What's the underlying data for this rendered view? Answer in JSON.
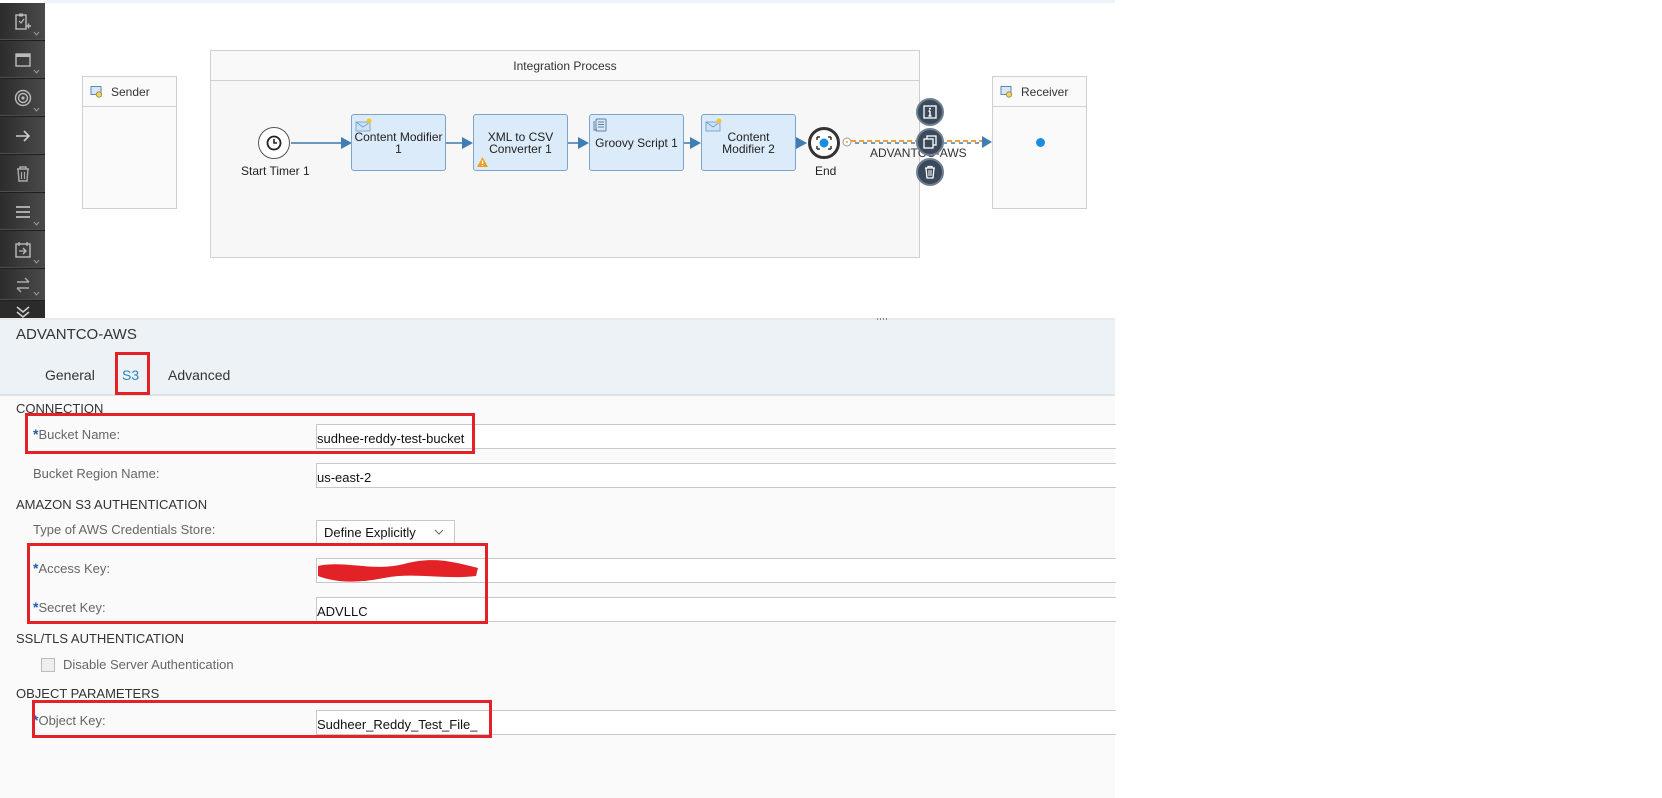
{
  "palette": {
    "items": [
      {
        "icon": "clipboard-add-icon",
        "has_dropdown": true
      },
      {
        "icon": "window-icon",
        "has_dropdown": true
      },
      {
        "icon": "target-icon",
        "has_dropdown": true
      },
      {
        "icon": "arrow-right-icon",
        "has_dropdown": false
      },
      {
        "icon": "trash-icon",
        "has_dropdown": false
      },
      {
        "icon": "menu-lines-icon",
        "has_dropdown": true
      },
      {
        "icon": "calendar-import-icon",
        "has_dropdown": true
      },
      {
        "icon": "swap-arrows-icon",
        "has_dropdown": true
      }
    ],
    "collapse_icon": "double-chevron-down-icon"
  },
  "diagram": {
    "sender": {
      "label": "Sender"
    },
    "receiver": {
      "label": "Receiver"
    },
    "pool": {
      "label": "Integration Process"
    },
    "start_event": {
      "label": "Start Timer 1",
      "icon": "clock-icon"
    },
    "steps": [
      {
        "label": "Content Modifier 1",
        "icon": "envelope-icon",
        "warning": false
      },
      {
        "label": "XML to CSV Converter 1",
        "icon": "",
        "warning": true
      },
      {
        "label": "Groovy Script 1",
        "icon": "script-icon",
        "warning": false
      },
      {
        "label": "Content Modifier 2",
        "icon": "envelope-icon",
        "warning": false
      }
    ],
    "end_event": {
      "label": "End",
      "icon": "message-end-icon"
    },
    "channel": {
      "label": "ADVANTCO-AWS",
      "selected": true
    },
    "context_buttons": [
      "info-icon",
      "copy-icon",
      "trash-icon"
    ]
  },
  "properties": {
    "title": "ADVANTCO-AWS",
    "tabs": [
      {
        "label": "General",
        "active": false
      },
      {
        "label": "S3",
        "active": true
      },
      {
        "label": "Advanced",
        "active": false
      }
    ],
    "sections": {
      "connection": "CONNECTION",
      "auth": "AMAZON S3 AUTHENTICATION",
      "ssl": "SSL/TLS AUTHENTICATION",
      "object": "OBJECT PARAMETERS"
    },
    "fields": {
      "bucket_name": {
        "label": "Bucket Name:",
        "required": true,
        "value": "sudhee-reddy-test-bucket"
      },
      "bucket_region": {
        "label": "Bucket Region Name:",
        "required": false,
        "value": "us-east-2"
      },
      "credentials_store": {
        "label": "Type of AWS Credentials Store:",
        "value": "Define Explicitly"
      },
      "access_key": {
        "label": "Access Key:",
        "required": true,
        "value": "[redacted]"
      },
      "secret_key": {
        "label": "Secret Key:",
        "required": true,
        "value": "ADVLLC"
      },
      "disable_server_auth": {
        "label": "Disable Server Authentication",
        "checked": false
      },
      "object_key": {
        "label": "Object Key:",
        "required": true,
        "value": "Sudheer_Reddy_Test_File_"
      }
    }
  },
  "colors": {
    "annotation_red": "#e32228",
    "step_fill": "#dcebf9",
    "step_border": "#7aa4cb",
    "active_tab": "#2a86c5",
    "channel_dash": "#f0a030"
  }
}
